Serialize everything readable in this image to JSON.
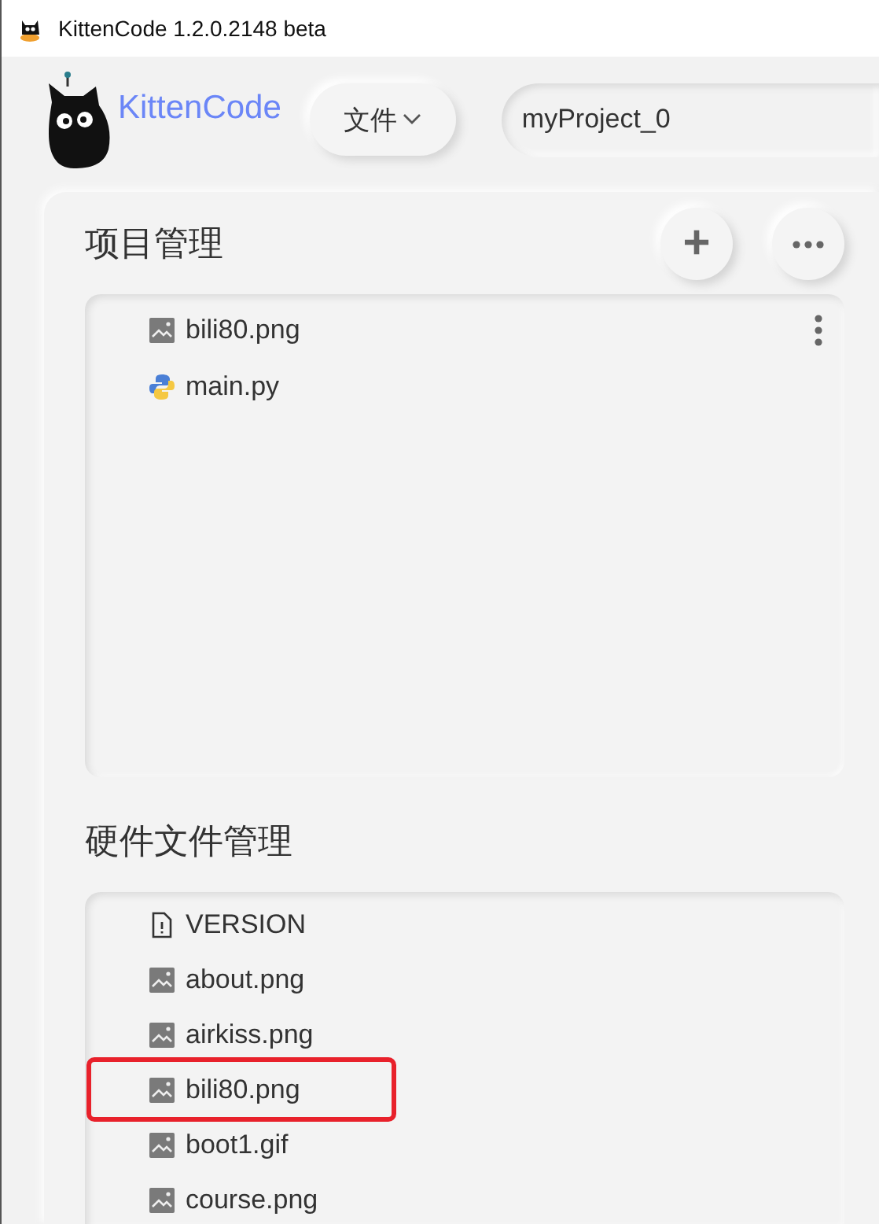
{
  "window": {
    "title": "KittenCode 1.2.0.2148 beta"
  },
  "header": {
    "logo_text": "KittenCode",
    "file_menu": "文件",
    "project_name": "myProject_0"
  },
  "project_panel": {
    "title": "项目管理",
    "add_button": "+",
    "files": [
      {
        "name": "bili80.png",
        "kind": "image",
        "menu": true
      },
      {
        "name": "main.py",
        "kind": "python",
        "menu": false
      }
    ]
  },
  "hardware_panel": {
    "title": "硬件文件管理",
    "files": [
      {
        "name": "VERSION",
        "kind": "file",
        "highlighted": false
      },
      {
        "name": "about.png",
        "kind": "image",
        "highlighted": false
      },
      {
        "name": "airkiss.png",
        "kind": "image",
        "highlighted": false
      },
      {
        "name": "bili80.png",
        "kind": "image",
        "highlighted": true
      },
      {
        "name": "boot1.gif",
        "kind": "image",
        "highlighted": false
      },
      {
        "name": "course.png",
        "kind": "image",
        "highlighted": false
      }
    ]
  }
}
